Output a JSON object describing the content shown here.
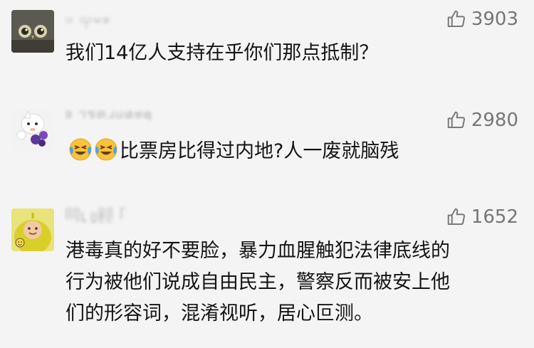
{
  "comments": [
    {
      "username": "ၒ ၺမၶ",
      "likes": "3903",
      "lines": [
        "我们14亿人支持在乎你们那点抵制？"
      ],
      "avatar_icon": "owl-avatar"
    },
    {
      "username": "ᥑ ᥐᥓᥖᥘᥙᥚᥛᥜ",
      "likes": "2980",
      "emoji_icon": "tears-of-joy-emoji",
      "lines": [
        "比票房比得过内地?人一废就脑残"
      ],
      "avatar_icon": "cartoon-avatar"
    },
    {
      "username": "ᥥᥦᥧ ᥩᥪᥫ ᥬ",
      "likes": "1652",
      "lines": [
        "港毒真的好不要脸，暴力血腥触犯法律底线的",
        "行为被他们说成自由民主，警察反而被安上他",
        "们的形容词，混淆视听，居心叵测。"
      ],
      "avatar_icon": "teletubby-avatar"
    }
  ],
  "colors": {
    "background": "#f4f4f4",
    "text": "#141414",
    "muted": "#767676",
    "emoji_face": "#f9c23c"
  }
}
